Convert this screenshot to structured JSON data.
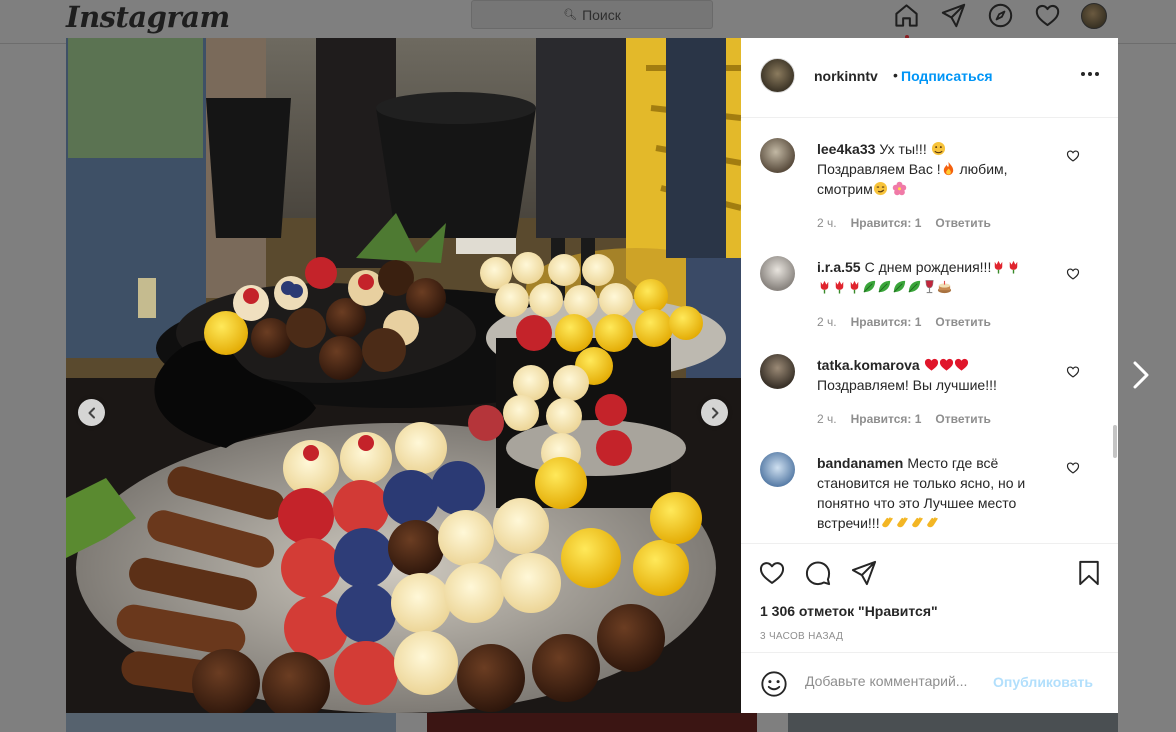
{
  "app": {
    "logo": "Instagram"
  },
  "search": {
    "placeholder": "Поиск"
  },
  "nav_icons": [
    "home-icon",
    "direct-icon",
    "explore-icon",
    "activity-heart-icon",
    "profile-avatar"
  ],
  "post": {
    "username": "norkinntv",
    "separator": "•",
    "follow_label": "Подписаться",
    "carousel": {
      "current_index": 2,
      "total": 3
    },
    "likes_text": "1 306 отметок \"Нравится\"",
    "time_ago": "3 ЧАСОВ НАЗАД"
  },
  "comments": [
    {
      "username": "lee4ka33",
      "text_parts": [
        "Ух ты!!! ",
        "{emoji:hugging-face}",
        " Поздравляем Вас !",
        "{emoji:fire}",
        " любим, смотрим",
        "{emoji:smirk}",
        " ",
        "{emoji:hibiscus}"
      ],
      "time": "2 ч.",
      "likes": "Нравится: 1",
      "reply": "Ответить"
    },
    {
      "username": "i.r.a.55",
      "text_parts": [
        "С днем рождения!!!",
        "{emoji:tulip}",
        "{emoji:tulip}",
        " ",
        "{emoji:tulip}",
        "{emoji:tulip}",
        "{emoji:tulip}",
        "{emoji:leaf}",
        "{emoji:leaf}",
        "{emoji:leaf}",
        "{emoji:leaf}",
        "{emoji:wine}",
        "{emoji:cake}"
      ],
      "time": "2 ч.",
      "likes": "Нравится: 1",
      "reply": "Ответить"
    },
    {
      "username": "tatka.komarova",
      "text_parts": [
        "{emoji:heart}",
        "{emoji:heart}",
        "{emoji:heart}",
        " Поздравляем! Вы лучшие!!!"
      ],
      "time": "2 ч.",
      "likes": "Нравится: 1",
      "reply": "Ответить"
    },
    {
      "username": "bandanamen",
      "text_parts": [
        "Место где всё становится не только ясно, но и понятно что это Лучшее место встречи!!!",
        "{emoji:clap}",
        "{emoji:clap}",
        "{emoji:clap}",
        "{emoji:clap}"
      ],
      "time": "",
      "likes": "",
      "reply": ""
    }
  ],
  "add_comment": {
    "placeholder": "Добавьте комментарий...",
    "post_label": "Опубликовать"
  },
  "colors": {
    "link_blue": "#0095f6",
    "post_disabled": "#b2dffc",
    "meta_gray": "#8e8e8e",
    "overlay_gray": "#7f7f7f"
  }
}
